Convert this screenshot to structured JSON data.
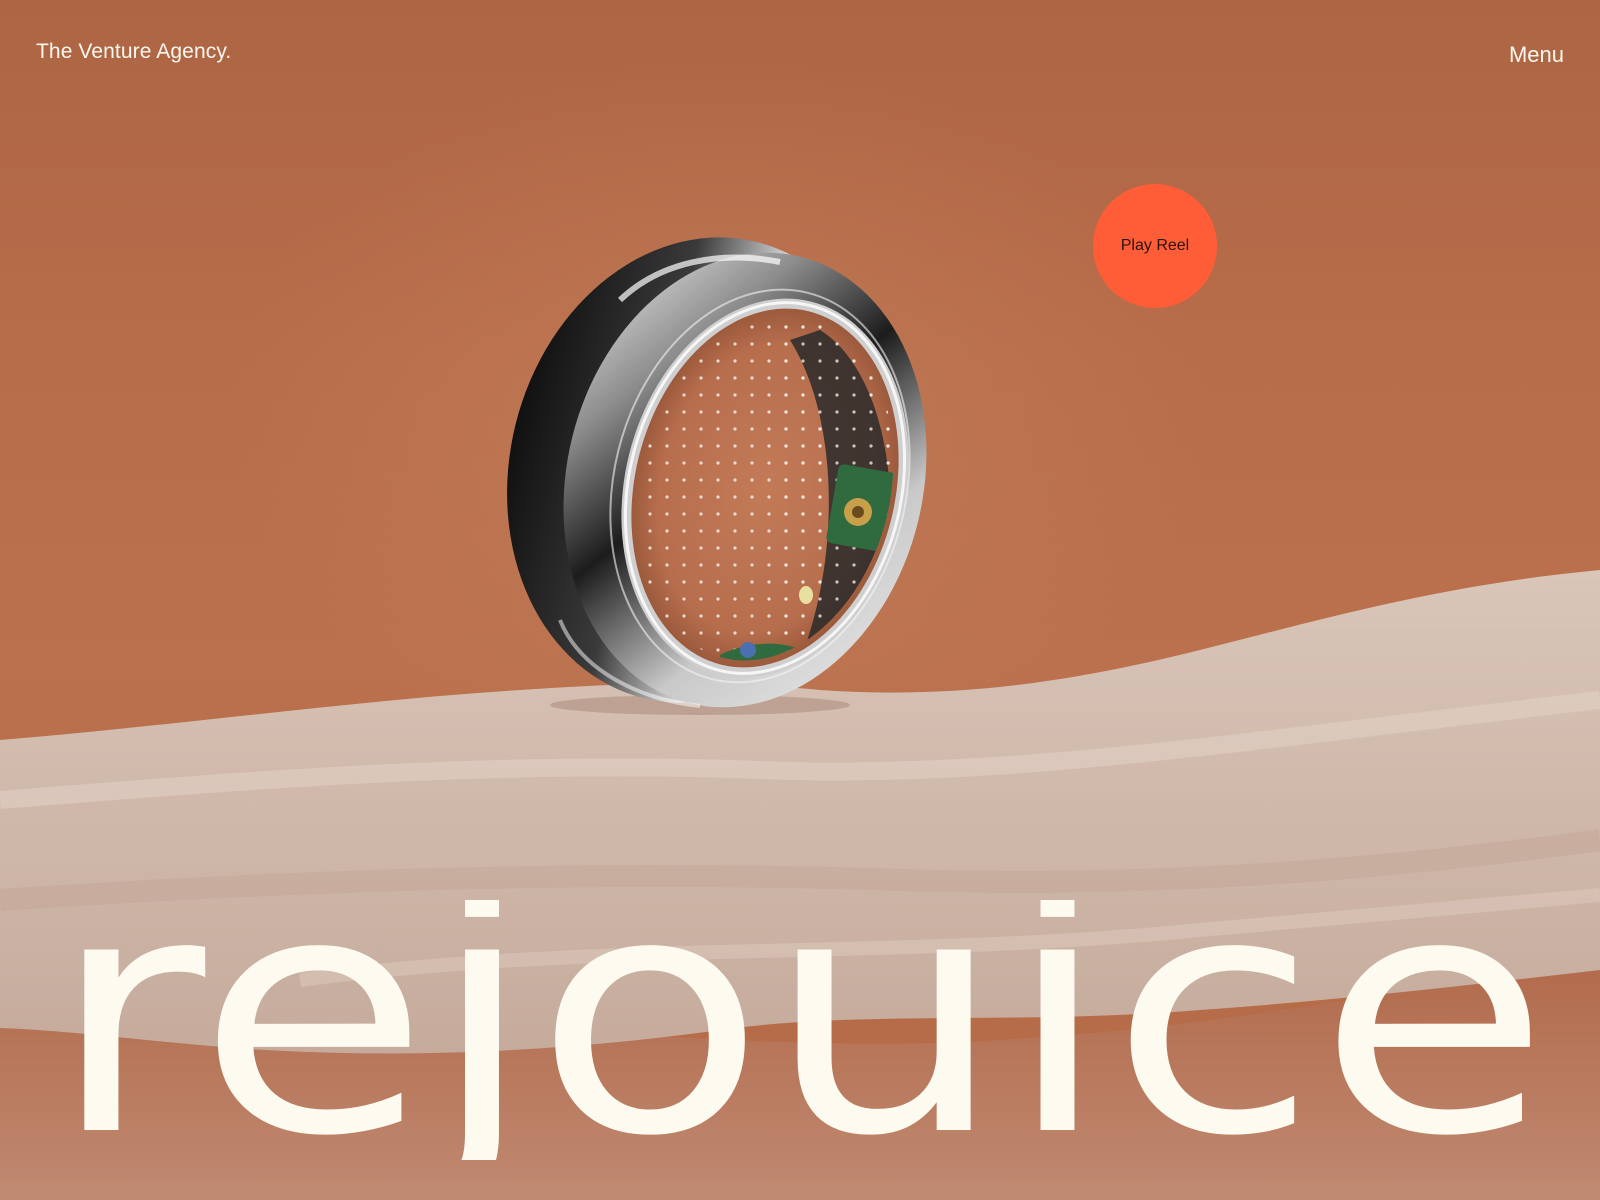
{
  "header": {
    "brand": "The Venture Agency.",
    "menu_label": "Menu"
  },
  "hero": {
    "play_reel_label": "Play Reel",
    "wordmark": "rejouice",
    "product_image": "smart-ring-on-silk-fabric"
  },
  "colors": {
    "background": "#b86c48",
    "play_button": "#ff5d38",
    "text_light": "#fbf7ee",
    "fabric": "#d7c3b6"
  }
}
